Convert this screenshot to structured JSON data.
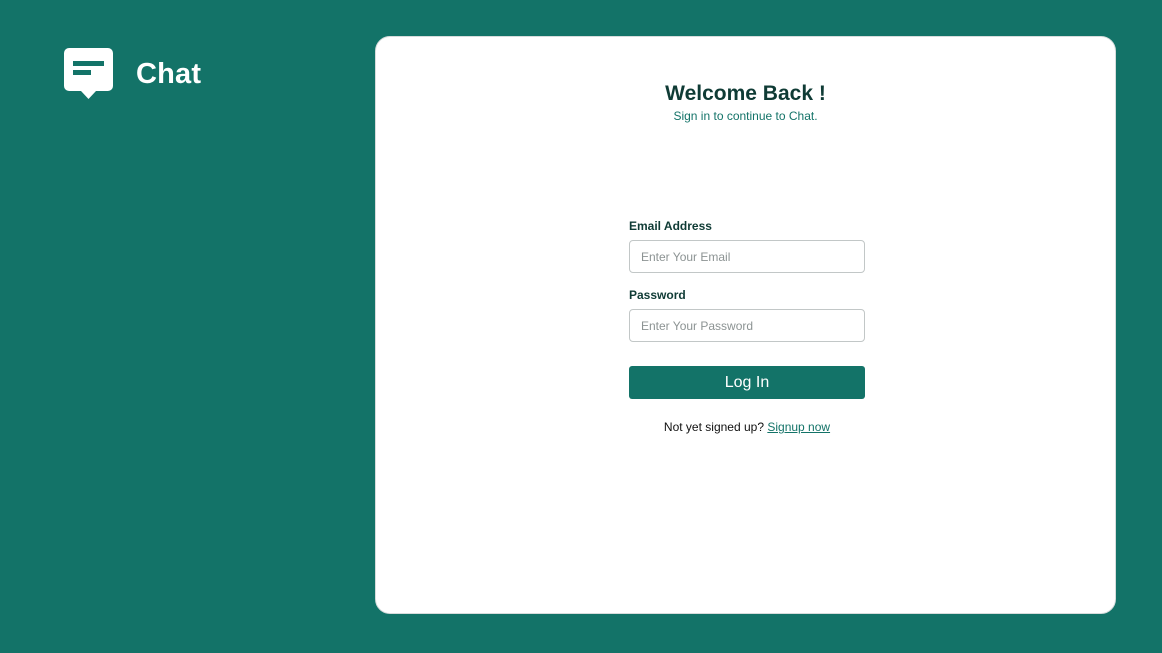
{
  "brand": {
    "name": "Chat",
    "icon": "chat-bubble-icon"
  },
  "login": {
    "title": "Welcome Back !",
    "subtitle": "Sign in to continue to Chat.",
    "email": {
      "label": "Email Address",
      "placeholder": "Enter Your Email",
      "value": ""
    },
    "password": {
      "label": "Password",
      "placeholder": "Enter Your Password",
      "value": ""
    },
    "submit_label": "Log In",
    "signup_prompt": "Not yet signed up?",
    "signup_link": "Signup now"
  },
  "colors": {
    "background": "#137368",
    "card": "#ffffff",
    "heading": "#0f3b35",
    "accent": "#137368"
  }
}
